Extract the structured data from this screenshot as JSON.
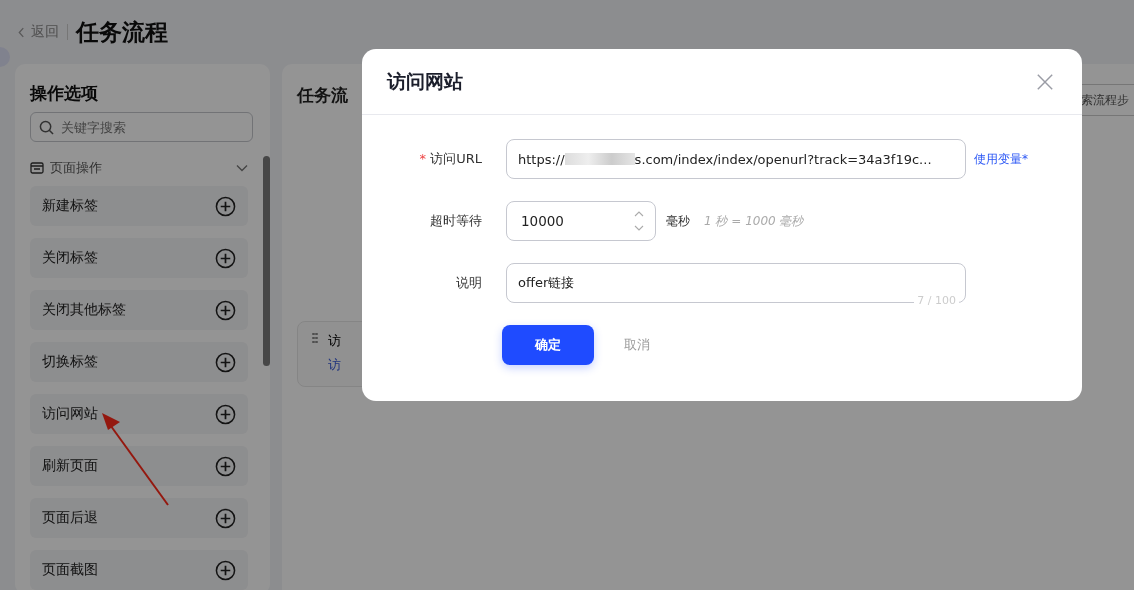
{
  "header": {
    "back": "返回",
    "title": "任务流程"
  },
  "sidebar": {
    "title": "操作选项",
    "search": {
      "placeholder": "关键字搜索"
    },
    "group": {
      "label": "页面操作",
      "expanded": true
    },
    "items": [
      {
        "label": "新建标签"
      },
      {
        "label": "关闭标签"
      },
      {
        "label": "关闭其他标签"
      },
      {
        "label": "切换标签"
      },
      {
        "label": "访问网站"
      },
      {
        "label": "刷新页面"
      },
      {
        "label": "页面后退"
      },
      {
        "label": "页面截图"
      }
    ]
  },
  "main": {
    "title": "任务流",
    "search": {
      "placeholder": "索流程步"
    },
    "step": {
      "title": "访",
      "subtitle": "访"
    }
  },
  "dialog": {
    "title": "访问网站",
    "url": {
      "label": "访问URL",
      "required_mark": "*",
      "value_start": "https://",
      "value_end": "s.com/index/index/openurl?track=34a3f19c...",
      "link": "使用变量*"
    },
    "timeout": {
      "label": "超时等待",
      "value": "10000",
      "unit": "毫秒",
      "hint": "1 秒 = 1000 毫秒"
    },
    "note": {
      "label": "说明",
      "value": "offer链接",
      "counter": "7 / 100"
    },
    "buttons": {
      "confirm": "确定",
      "cancel": "取消"
    }
  }
}
